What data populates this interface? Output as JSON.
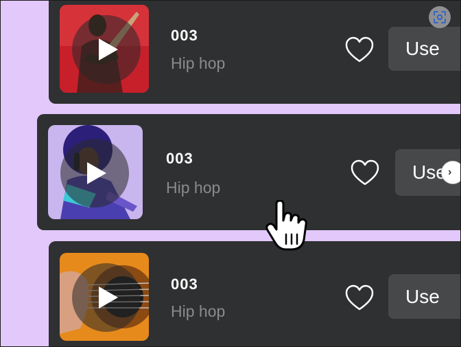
{
  "tracks": [
    {
      "title": "003",
      "genre": "Hip hop",
      "use_label": "Use"
    },
    {
      "title": "003",
      "genre": "Hip hop",
      "use_label": "Use"
    },
    {
      "title": "003",
      "genre": "Hip hop",
      "use_label": "Use"
    }
  ],
  "icons": {
    "play": "play-icon",
    "favorite": "heart-outline-icon",
    "scan": "scan-icon",
    "next": "chevron-right-icon",
    "cursor": "hand-pointer-cursor"
  },
  "next_arrow_label": "›",
  "colors": {
    "page_background": "#e2c8fb",
    "card_background": "#2f3031",
    "button_background": "#46484a",
    "title_text": "#ffffff",
    "genre_text": "#8a8b8d"
  }
}
